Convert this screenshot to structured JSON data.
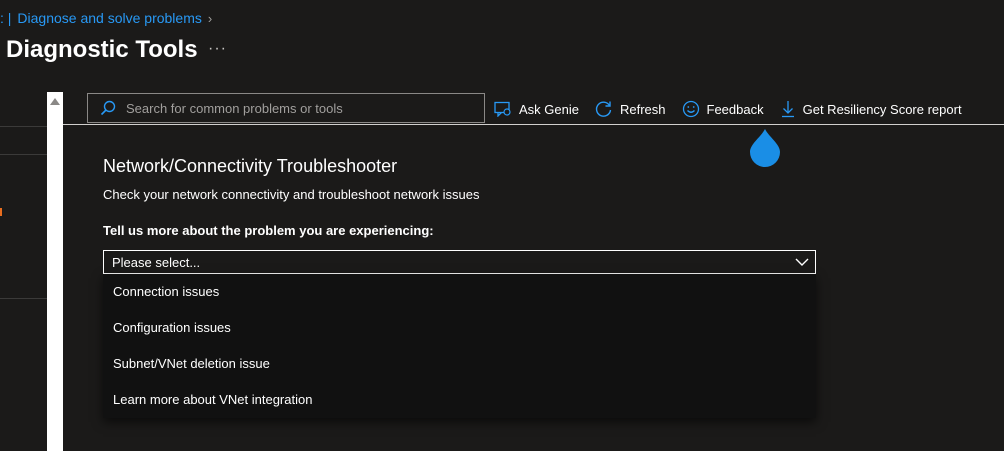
{
  "breadcrumb": {
    "prefix": ": |",
    "current": "Diagnose and solve problems",
    "separator": "›"
  },
  "page": {
    "title": "Diagnostic Tools",
    "more": "···"
  },
  "search": {
    "placeholder": "Search for common problems or tools",
    "value": ""
  },
  "toolbar": {
    "ask_genie": "Ask Genie",
    "refresh": "Refresh",
    "feedback": "Feedback",
    "resiliency": "Get Resiliency Score report"
  },
  "troubleshooter": {
    "title": "Network/Connectivity Troubleshooter",
    "description": "Check your network connectivity and troubleshoot network issues",
    "question": "Tell us more about the problem you are experiencing:",
    "selected": "Please select...",
    "options": [
      "Connection issues",
      "Configuration issues",
      "Subnet/VNet deletion issue",
      "Learn more about VNet integration"
    ]
  },
  "colors": {
    "background": "#1b1a19",
    "link": "#2899f5",
    "accent": "#0078d4",
    "drop_indicator": "#1a8ee6"
  },
  "icons": {
    "search": "search-icon",
    "ask_genie": "genie-chat-icon",
    "refresh": "refresh-icon",
    "feedback": "smiley-icon",
    "resiliency": "download-icon"
  }
}
